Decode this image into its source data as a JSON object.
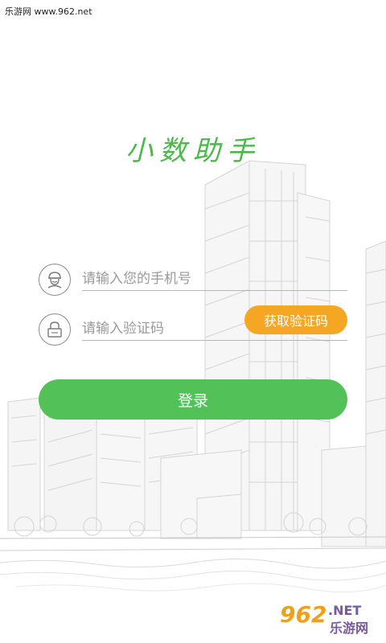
{
  "watermark": {
    "top_left": "乐游网 www.962.net"
  },
  "app": {
    "title": "小数助手"
  },
  "form": {
    "phone": {
      "placeholder": "请输入您的手机号",
      "value": "",
      "icon": "user-avatar-icon"
    },
    "code": {
      "placeholder": "请输入验证码",
      "value": "",
      "icon": "lock-icon"
    },
    "get_code_label": "获取验证码",
    "login_label": "登录"
  },
  "colors": {
    "title": "#4ab84a",
    "login_button": "#52c258",
    "get_code_button": "#f5a623",
    "input_line": "#b5b5b5"
  },
  "corner_logo": {
    "brand": "962",
    "net": ".NET",
    "cn": "乐游网"
  }
}
